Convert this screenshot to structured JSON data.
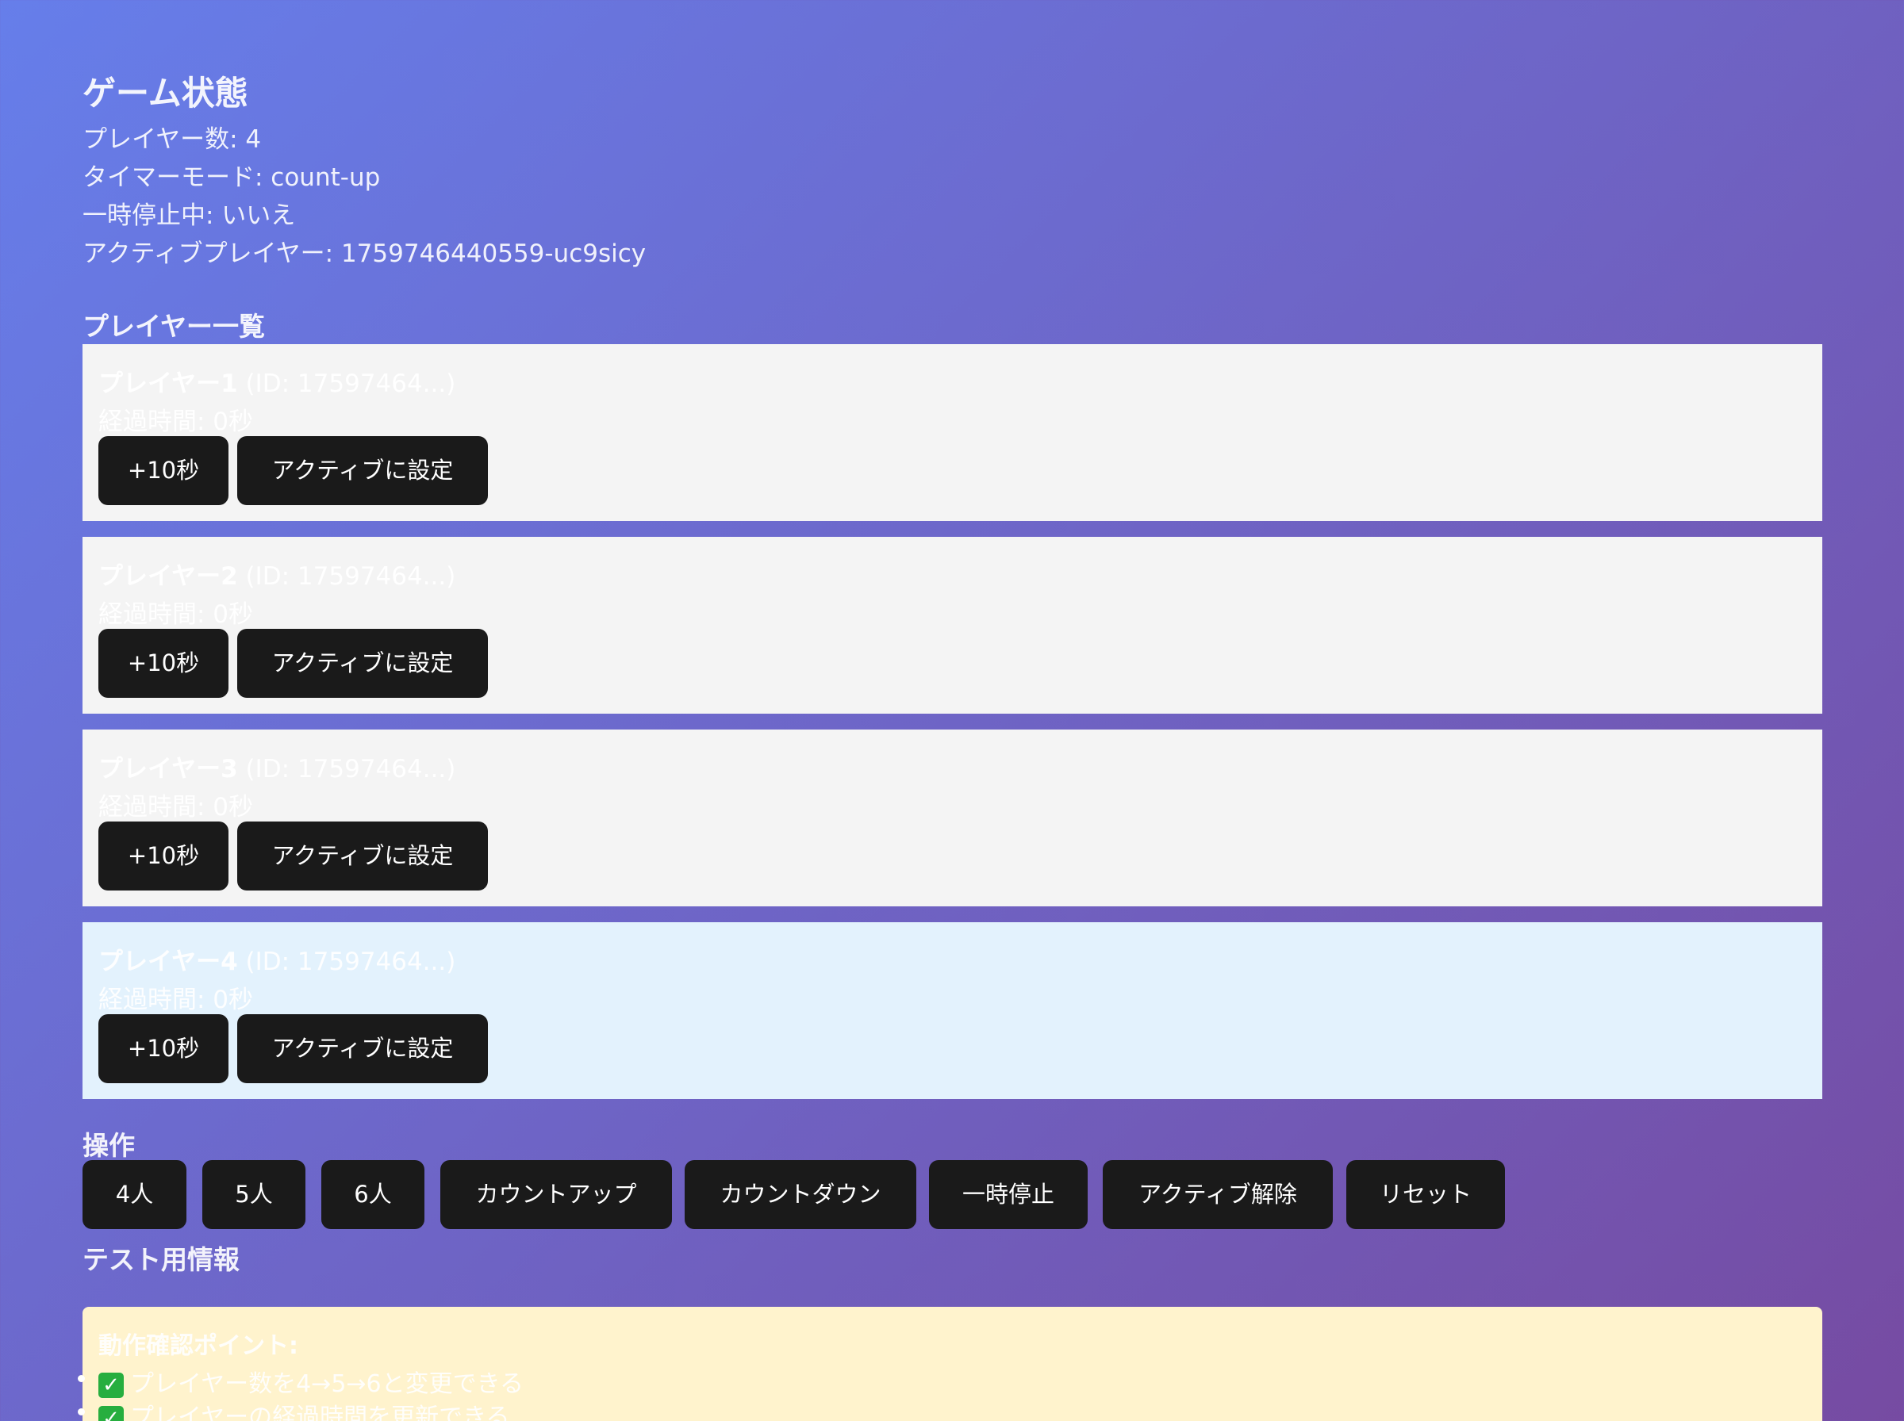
{
  "game_state": {
    "heading": "ゲーム状態",
    "player_count": "プレイヤー数: 4",
    "timer_mode": "タイマーモード: count-up",
    "paused": "一時停止中: いいえ",
    "active_player": "アクティブプレイヤー: 1759746440559-uc9sicy"
  },
  "player_list": {
    "heading": "プレイヤー一覧",
    "players": [
      {
        "name": "プレイヤー1",
        "id_text": " (ID: 17597464...)",
        "elapsed": "経過時間: 0秒",
        "add_button": "+10秒",
        "set_active_button": "アクティブに設定",
        "active": false
      },
      {
        "name": "プレイヤー2",
        "id_text": " (ID: 17597464...)",
        "elapsed": "経過時間: 0秒",
        "add_button": "+10秒",
        "set_active_button": "アクティブに設定",
        "active": false
      },
      {
        "name": "プレイヤー3",
        "id_text": " (ID: 17597464...)",
        "elapsed": "経過時間: 0秒",
        "add_button": "+10秒",
        "set_active_button": "アクティブに設定",
        "active": false
      },
      {
        "name": "プレイヤー4",
        "id_text": " (ID: 17597464...)",
        "elapsed": "経過時間: 0秒",
        "add_button": "+10秒",
        "set_active_button": "アクティブに設定",
        "active": true
      }
    ]
  },
  "controls": {
    "heading": "操作",
    "buttons": [
      "4人",
      "5人",
      "6人",
      "カウントアップ",
      "カウントダウン",
      "一時停止",
      "アクティブ解除",
      "リセット"
    ]
  },
  "test_info": {
    "heading": "テスト用情報",
    "box_title": "動作確認ポイント:",
    "items": [
      "プレイヤー数を4→5→6と変更できる",
      "プレイヤーの経過時間を更新できる"
    ],
    "check_glyph": "✓"
  },
  "colors": {
    "gradient_start": "#667eea",
    "gradient_end": "#764ba2",
    "card_bg": "#f4f4f4",
    "active_card_bg": "#e3f2fd",
    "button_bg": "#1a1a1a",
    "test_box_bg": "#fff3cd"
  }
}
